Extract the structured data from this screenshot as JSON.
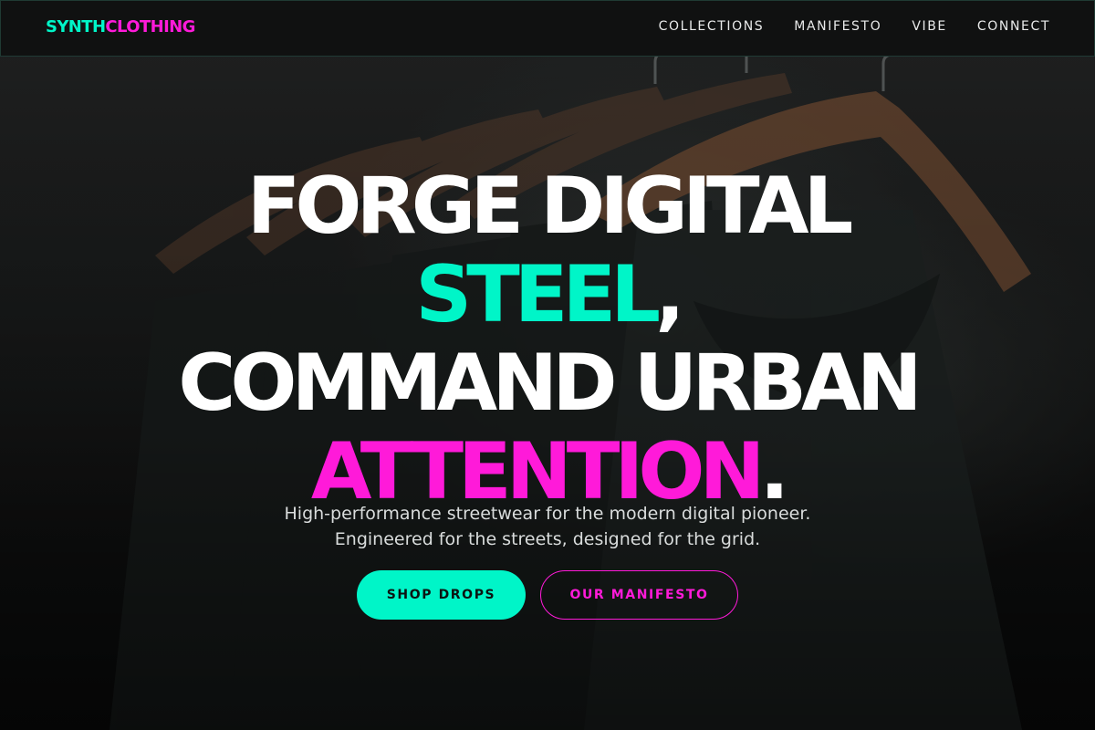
{
  "brand": {
    "part_a": "SYNTH",
    "part_b": "CLOTHING",
    "color_a": "#00f5c8",
    "color_b": "#ff1ad9"
  },
  "nav": {
    "items": [
      {
        "label": "COLLECTIONS"
      },
      {
        "label": "MANIFESTO"
      },
      {
        "label": "VIBE"
      },
      {
        "label": "CONNECT"
      }
    ]
  },
  "hero": {
    "headline": {
      "line1": "FORGE DIGITAL",
      "line2_highlight": "STEEL",
      "line2_punct": ",",
      "line3": "COMMAND URBAN",
      "line4_highlight": "ATTENTION",
      "line4_punct": "."
    },
    "subtext": {
      "line1": "High-performance streetwear for the modern digital pioneer.",
      "line2": "Engineered for the streets, designed for the grid."
    },
    "cta_primary": "SHOP DROPS",
    "cta_secondary": "OUR MANIFESTO",
    "background": "photo of dark t-shirts on wooden hangers",
    "colors": {
      "accent_teal": "#00f5c8",
      "accent_magenta": "#ff1ad9"
    }
  }
}
